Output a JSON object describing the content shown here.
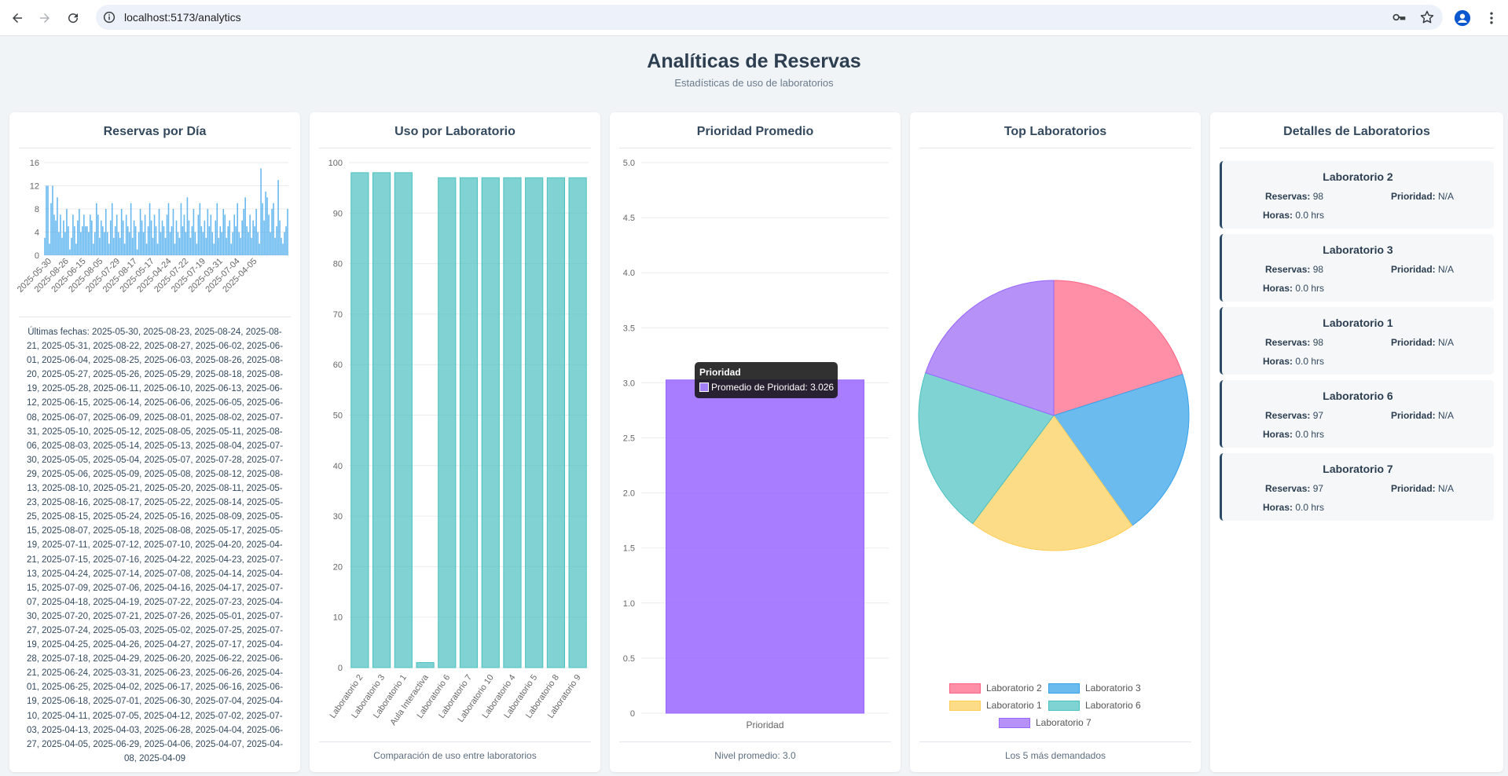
{
  "browser": {
    "url": "localhost:5173/analytics"
  },
  "page": {
    "title": "Analíticas de Reservas",
    "subtitle": "Estadísticas de uso de laboratorios"
  },
  "cards": {
    "daily": {
      "title": "Reservas por Día",
      "dates_text": "Últimas fechas: 2025-05-30, 2025-08-23, 2025-08-24, 2025-08-21, 2025-05-31, 2025-08-22, 2025-08-27, 2025-06-02, 2025-06-01, 2025-06-04, 2025-08-25, 2025-06-03, 2025-08-26, 2025-08-20, 2025-05-27, 2025-05-26, 2025-05-29, 2025-08-18, 2025-08-19, 2025-05-28, 2025-06-11, 2025-06-10, 2025-06-13, 2025-06-12, 2025-06-15, 2025-06-14, 2025-06-06, 2025-06-05, 2025-06-08, 2025-06-07, 2025-06-09, 2025-08-01, 2025-08-02, 2025-07-31, 2025-05-10, 2025-05-12, 2025-08-05, 2025-05-11, 2025-08-06, 2025-08-03, 2025-05-14, 2025-05-13, 2025-08-04, 2025-07-30, 2025-05-05, 2025-05-04, 2025-05-07, 2025-07-28, 2025-07-29, 2025-05-06, 2025-05-09, 2025-05-08, 2025-08-12, 2025-08-13, 2025-08-10, 2025-05-21, 2025-05-20, 2025-08-11, 2025-05-23, 2025-08-16, 2025-08-17, 2025-05-22, 2025-08-14, 2025-05-25, 2025-08-15, 2025-05-24, 2025-05-16, 2025-08-09, 2025-05-15, 2025-08-07, 2025-05-18, 2025-08-08, 2025-05-17, 2025-05-19, 2025-07-11, 2025-07-12, 2025-07-10, 2025-04-20, 2025-04-21, 2025-07-15, 2025-07-16, 2025-04-22, 2025-04-23, 2025-07-13, 2025-04-24, 2025-07-14, 2025-07-08, 2025-04-14, 2025-04-15, 2025-07-09, 2025-07-06, 2025-04-16, 2025-04-17, 2025-07-07, 2025-04-18, 2025-04-19, 2025-07-22, 2025-07-23, 2025-04-30, 2025-07-20, 2025-07-21, 2025-07-26, 2025-05-01, 2025-07-27, 2025-07-24, 2025-05-03, 2025-05-02, 2025-07-25, 2025-07-19, 2025-04-25, 2025-04-26, 2025-04-27, 2025-07-17, 2025-04-28, 2025-07-18, 2025-04-29, 2025-06-20, 2025-06-22, 2025-06-21, 2025-06-24, 2025-03-31, 2025-06-23, 2025-06-26, 2025-04-01, 2025-06-25, 2025-04-02, 2025-06-17, 2025-06-16, 2025-06-19, 2025-06-18, 2025-07-01, 2025-06-30, 2025-07-04, 2025-04-10, 2025-04-11, 2025-07-05, 2025-04-12, 2025-07-02, 2025-07-03, 2025-04-13, 2025-04-03, 2025-06-28, 2025-04-04, 2025-06-27, 2025-04-05, 2025-06-29, 2025-04-06, 2025-04-07, 2025-04-08, 2025-04-09"
    },
    "usage": {
      "title": "Uso por Laboratorio",
      "footer": "Comparación de uso entre laboratorios"
    },
    "priority": {
      "title": "Prioridad Promedio",
      "footer": "Nivel promedio: 3.0",
      "tooltip_title": "Prioridad",
      "tooltip_label": "Promedio de Prioridad: 3.026"
    },
    "top": {
      "title": "Top Laboratorios",
      "footer": "Los 5 más demandados"
    },
    "details": {
      "title": "Detalles de Laboratorios",
      "reservas_label": "Reservas:",
      "prioridad_label": "Prioridad:",
      "horas_label": "Horas:",
      "items": [
        {
          "name": "Laboratorio 2",
          "reservas": "98",
          "prioridad": "N/A",
          "horas": "0.0 hrs"
        },
        {
          "name": "Laboratorio 3",
          "reservas": "98",
          "prioridad": "N/A",
          "horas": "0.0 hrs"
        },
        {
          "name": "Laboratorio 1",
          "reservas": "98",
          "prioridad": "N/A",
          "horas": "0.0 hrs"
        },
        {
          "name": "Laboratorio 6",
          "reservas": "97",
          "prioridad": "N/A",
          "horas": "0.0 hrs"
        },
        {
          "name": "Laboratorio 7",
          "reservas": "97",
          "prioridad": "N/A",
          "horas": "0.0 hrs"
        }
      ]
    }
  },
  "chart_data": [
    {
      "type": "bar",
      "title": "Reservas por Día",
      "ylim": [
        0,
        16
      ],
      "yticks": [
        0,
        4,
        8,
        12,
        16
      ],
      "xtick_labels": [
        "2025-05-30",
        "2025-08-26",
        "2025-06-15",
        "2025-08-05",
        "2025-07-29",
        "2025-08-17",
        "2025-05-17",
        "2025-04-24",
        "2025-07-22",
        "2025-07-19",
        "2025-03-31",
        "2025-07-04",
        "2025-04-05"
      ],
      "color": "#36a2eb",
      "values": [
        3,
        12,
        12,
        2,
        9,
        12,
        7,
        6,
        10,
        4,
        7,
        3,
        6,
        4,
        8,
        5,
        1,
        3,
        7,
        5,
        2,
        6,
        8,
        4,
        5,
        7,
        5,
        5,
        4,
        7,
        6,
        2,
        4,
        9,
        7,
        3,
        6,
        5,
        4,
        8,
        4,
        2,
        6,
        9,
        3,
        5,
        7,
        4,
        3,
        8,
        6,
        2,
        7,
        5,
        4,
        9,
        3,
        6,
        5,
        1,
        4,
        8,
        6,
        4,
        7,
        2,
        5,
        9,
        6,
        3,
        7,
        5,
        2,
        8,
        4,
        6,
        5,
        3,
        7,
        9,
        4,
        5,
        8,
        2,
        6,
        4,
        3,
        9,
        5,
        7,
        4,
        10,
        6,
        3,
        5,
        8,
        4,
        2,
        7,
        9,
        5,
        4,
        6,
        3,
        8,
        5,
        7,
        4,
        2,
        6,
        9,
        3,
        5,
        4,
        8,
        7,
        3,
        5,
        6,
        2,
        4,
        7,
        5,
        9,
        4,
        3,
        6,
        8,
        10,
        5,
        4,
        7,
        3,
        6,
        5,
        8,
        4,
        2,
        15,
        9,
        6,
        11,
        10,
        7,
        4,
        8,
        9,
        3,
        5,
        13,
        6,
        3,
        2,
        4,
        5,
        8
      ]
    },
    {
      "type": "bar",
      "title": "Uso por Laboratorio",
      "categories": [
        "Laboratorio 2",
        "Laboratorio 3",
        "Laboratorio 1",
        "Aula Interactiva",
        "Laboratorio 6",
        "Laboratorio 7",
        "Laboratorio 10",
        "Laboratorio 4",
        "Laboratorio 5",
        "Laboratorio 8",
        "Laboratorio 9"
      ],
      "values": [
        98,
        98,
        98,
        1,
        97,
        97,
        97,
        97,
        97,
        97,
        97
      ],
      "ylim": [
        0,
        100
      ],
      "yticks": [
        0,
        10,
        20,
        30,
        40,
        50,
        60,
        70,
        80,
        90,
        100
      ],
      "color": "#4bc0c0"
    },
    {
      "type": "bar",
      "title": "Prioridad Promedio",
      "categories": [
        "Prioridad"
      ],
      "values": [
        3.026
      ],
      "ylim": [
        0,
        5
      ],
      "yticks": [
        "0",
        "0.5",
        "1.0",
        "1.5",
        "2.0",
        "2.5",
        "3.0",
        "3.5",
        "4.0",
        "4.5",
        "5.0"
      ],
      "color": "#9966ff"
    },
    {
      "type": "pie",
      "title": "Top Laboratorios",
      "labels": [
        "Laboratorio 2",
        "Laboratorio 3",
        "Laboratorio 1",
        "Laboratorio 6",
        "Laboratorio 7"
      ],
      "values": [
        98,
        98,
        98,
        97,
        97
      ],
      "colors": [
        "#ff8fa6",
        "#6cbbef",
        "#fddc88",
        "#7fd3d3",
        "#b591f8"
      ],
      "borders": [
        "#ff6384",
        "#36a2eb",
        "#ffcd56",
        "#4bc0c0",
        "#9966ff"
      ]
    }
  ]
}
